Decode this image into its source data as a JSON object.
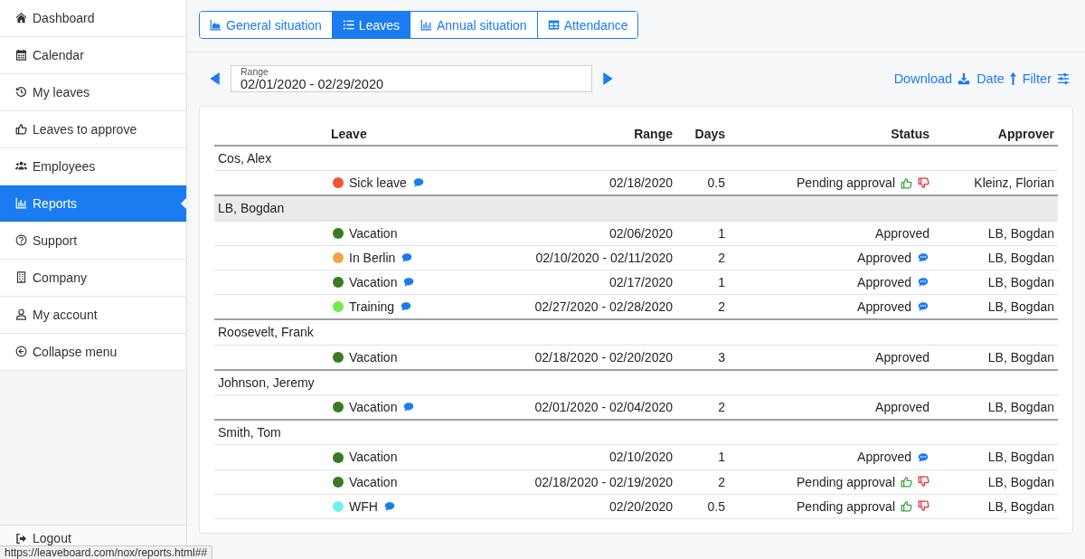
{
  "sidebar": {
    "items": [
      {
        "label": "Dashboard",
        "selected": false
      },
      {
        "label": "Calendar",
        "selected": false
      },
      {
        "label": "My leaves",
        "selected": false
      },
      {
        "label": "Leaves to approve",
        "selected": false
      },
      {
        "label": "Employees",
        "selected": false
      },
      {
        "label": "Reports",
        "selected": true
      },
      {
        "label": "Support",
        "selected": false
      },
      {
        "label": "Company",
        "selected": false
      },
      {
        "label": "My account",
        "selected": false
      },
      {
        "label": "Collapse menu",
        "selected": false
      }
    ],
    "logout": {
      "label": "Logout"
    }
  },
  "tabs": [
    {
      "label": "General situation",
      "selected": false
    },
    {
      "label": "Leaves",
      "selected": true
    },
    {
      "label": "Annual situation",
      "selected": false
    },
    {
      "label": "Attendance",
      "selected": false
    }
  ],
  "toolbar": {
    "range": {
      "label": "Range",
      "value": "02/01/2020 - 02/29/2020"
    },
    "actions": [
      {
        "label": "Download"
      },
      {
        "label": "Date"
      },
      {
        "label": "Filter"
      }
    ]
  },
  "table": {
    "columns": [
      "Leave",
      "Range",
      "Days",
      "Status",
      "Approver"
    ],
    "groups": [
      {
        "name": "Cos, Alex",
        "highlighted": false,
        "leaves": [
          {
            "type": "Sick leave",
            "color": "#ee5533",
            "note": true,
            "range": "02/18/2020",
            "days": "0.5",
            "status": "Pending approval",
            "kind": "pending",
            "status_note": false,
            "approver": "Kleinz, Florian"
          }
        ]
      },
      {
        "name": "LB, Bogdan",
        "highlighted": true,
        "leaves": [
          {
            "type": "Vacation",
            "color": "#3a7a22",
            "note": false,
            "range": "02/06/2020",
            "days": "1",
            "status": "Approved",
            "kind": "approved",
            "status_note": false,
            "approver": "LB, Bogdan"
          },
          {
            "type": "In Berlin",
            "color": "#f5a443",
            "note": true,
            "range": "02/10/2020 - 02/11/2020",
            "days": "2",
            "status": "Approved",
            "kind": "approved",
            "status_note": true,
            "approver": "LB, Bogdan"
          },
          {
            "type": "Vacation",
            "color": "#3a7a22",
            "note": true,
            "range": "02/17/2020",
            "days": "1",
            "status": "Approved",
            "kind": "approved",
            "status_note": true,
            "approver": "LB, Bogdan"
          },
          {
            "type": "Training",
            "color": "#72ec48",
            "note": true,
            "range": "02/27/2020 - 02/28/2020",
            "days": "2",
            "status": "Approved",
            "kind": "approved",
            "status_note": true,
            "approver": "LB, Bogdan"
          }
        ]
      },
      {
        "name": "Roosevelt, Frank",
        "highlighted": false,
        "leaves": [
          {
            "type": "Vacation",
            "color": "#3a7a22",
            "note": false,
            "range": "02/18/2020 - 02/20/2020",
            "days": "3",
            "status": "Approved",
            "kind": "approved",
            "status_note": false,
            "approver": "LB, Bogdan"
          }
        ]
      },
      {
        "name": "Johnson, Jeremy",
        "highlighted": false,
        "leaves": [
          {
            "type": "Vacation",
            "color": "#3a7a22",
            "note": true,
            "range": "02/01/2020 - 02/04/2020",
            "days": "2",
            "status": "Approved",
            "kind": "approved",
            "status_note": false,
            "approver": "LB, Bogdan"
          }
        ]
      },
      {
        "name": "Smith, Tom",
        "highlighted": false,
        "leaves": [
          {
            "type": "Vacation",
            "color": "#3a7a22",
            "note": false,
            "range": "02/10/2020",
            "days": "1",
            "status": "Approved",
            "kind": "approved",
            "status_note": true,
            "approver": "LB, Bogdan"
          },
          {
            "type": "Vacation",
            "color": "#3a7a22",
            "note": false,
            "range": "02/18/2020 - 02/19/2020",
            "days": "2",
            "status": "Pending approval",
            "kind": "pending",
            "status_note": false,
            "approver": "LB, Bogdan"
          },
          {
            "type": "WFH",
            "color": "#70f0f0",
            "note": true,
            "range": "02/20/2020",
            "days": "0.5",
            "status": "Pending approval",
            "kind": "pending",
            "status_note": false,
            "approver": "LB, Bogdan"
          }
        ]
      }
    ]
  },
  "status_url": "https://leaveboard.com/nox/reports.html##"
}
